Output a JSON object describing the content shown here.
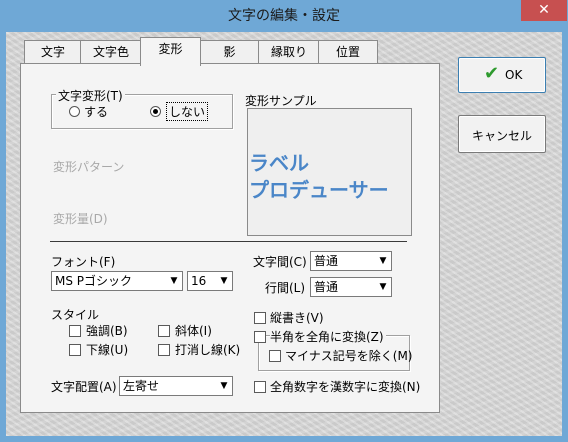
{
  "window": {
    "title": "文字の編集・設定",
    "close_glyph": "✕"
  },
  "tabs": [
    "文字",
    "文字色",
    "変形",
    "影",
    "縁取り",
    "位置"
  ],
  "active_tab": "変形",
  "transform": {
    "group_label": "文字変形(T)",
    "radio_on": "する",
    "radio_off": "しない",
    "selected": "しない",
    "pattern_label": "変形パターン",
    "amount_label": "変形量(D)",
    "sample_label": "変形サンプル",
    "sample_line1": "ラベル",
    "sample_line2": "プロデューサー"
  },
  "font": {
    "label": "フォント(F)",
    "name": "MS Pゴシック",
    "size": "16"
  },
  "spacing": {
    "char_label": "文字間(C)",
    "char_value": "普通",
    "line_label": "行間(L)",
    "line_value": "普通"
  },
  "style": {
    "label": "スタイル",
    "bold": "強調(B)",
    "italic": "斜体(I)",
    "underline": "下線(U)",
    "strike": "打消し線(K)"
  },
  "options": {
    "vertical": "縦書き(V)",
    "halfwidth": "半角を全角に変換(Z)",
    "minus": "マイナス記号を除く(M)",
    "kanji_digits": "全角数字を漢数字に変換(N)"
  },
  "alignment": {
    "label": "文字配置(A)",
    "value": "左寄せ"
  },
  "buttons": {
    "ok": "OK",
    "cancel": "キャンセル"
  },
  "colors": {
    "title_bar": "#6fa8d6",
    "close": "#c75050",
    "sample_text": "#4a86c8",
    "ok_check": "#2e9a2e"
  }
}
